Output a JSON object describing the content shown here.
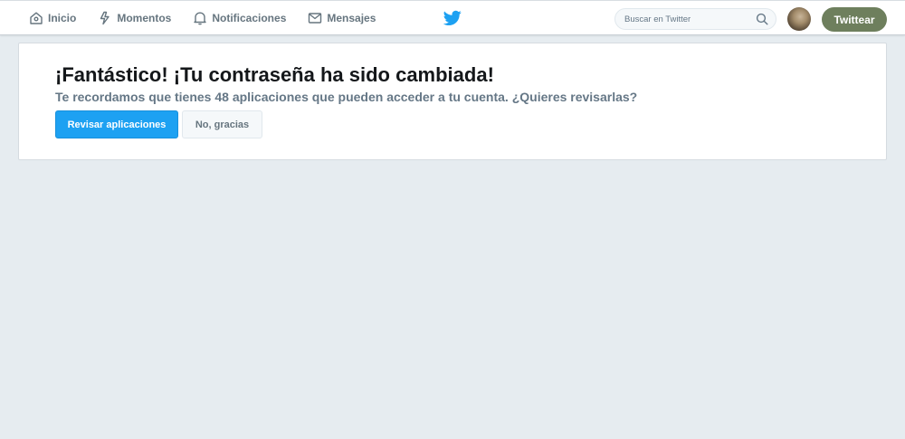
{
  "header": {
    "nav": [
      {
        "label": "Inicio",
        "icon": "home-icon"
      },
      {
        "label": "Momentos",
        "icon": "lightning-icon"
      },
      {
        "label": "Notificaciones",
        "icon": "bell-icon"
      },
      {
        "label": "Mensajes",
        "icon": "envelope-icon"
      }
    ],
    "logo_icon": "twitter-bird-icon",
    "search": {
      "placeholder": "Buscar en Twitter",
      "value": "",
      "icon": "search-icon"
    },
    "tweet_button_label": "Twittear",
    "colors": {
      "accent": "#1da1f2",
      "tweet_button": "#6e7f5d"
    }
  },
  "notice": {
    "title": "¡Fantástico! ¡Tu contraseña ha sido cambiada!",
    "subtitle": "Te recordamos que tienes 48 aplicaciones que pueden acceder a tu cuenta. ¿Quieres revisarlas?",
    "primary_button": "Revisar aplicaciones",
    "secondary_button": "No, gracias"
  }
}
